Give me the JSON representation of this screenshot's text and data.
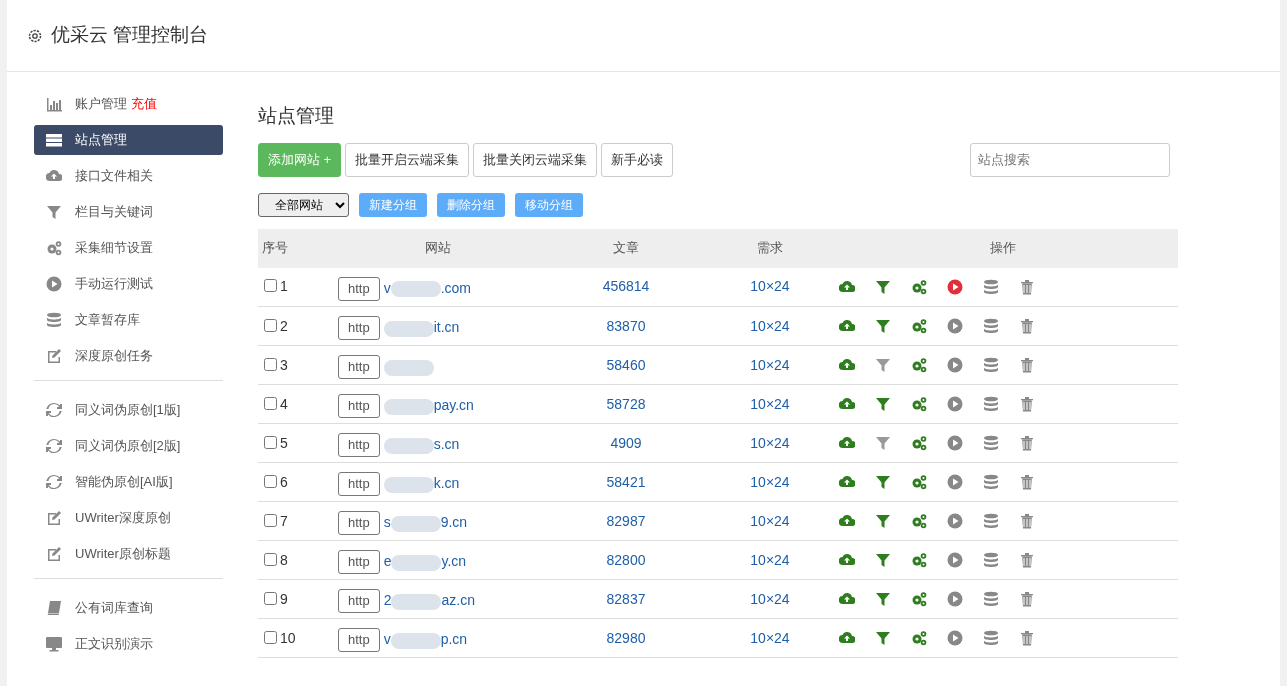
{
  "header": {
    "title": "优采云 管理控制台"
  },
  "sidebar": {
    "groups": [
      {
        "items": [
          {
            "label": "账户管理",
            "badge": "充值",
            "selected": false
          },
          {
            "label": "站点管理",
            "selected": true
          },
          {
            "label": "接口文件相关",
            "selected": false
          },
          {
            "label": "栏目与关键词",
            "selected": false
          },
          {
            "label": "采集细节设置",
            "selected": false
          },
          {
            "label": "手动运行测试",
            "selected": false
          },
          {
            "label": "文章暂存库",
            "selected": false
          },
          {
            "label": "深度原创任务",
            "selected": false
          }
        ]
      },
      {
        "items": [
          {
            "label": "同义词伪原创[1版]",
            "selected": false
          },
          {
            "label": "同义词伪原创[2版]",
            "selected": false
          },
          {
            "label": "智能伪原创[AI版]",
            "selected": false
          },
          {
            "label": "UWriter深度原创",
            "selected": false
          },
          {
            "label": "UWriter原创标题",
            "selected": false
          }
        ]
      },
      {
        "items": [
          {
            "label": "公有词库查询",
            "selected": false
          },
          {
            "label": "正文识别演示",
            "selected": false
          }
        ]
      }
    ]
  },
  "main": {
    "title": "站点管理",
    "buttons": [
      {
        "label": "添加网站 +",
        "kind": "primary"
      },
      {
        "label": "批量开启云端采集",
        "kind": "outline"
      },
      {
        "label": "批量关闭云端采集",
        "kind": "outline"
      },
      {
        "label": "新手必读",
        "kind": "outline"
      }
    ],
    "search": {
      "placeholder": "站点搜索"
    },
    "group_select": {
      "value": "全部网站"
    },
    "group_buttons": [
      "新建分组",
      "删除分组",
      "移动分组"
    ],
    "table": {
      "columns": [
        "序号",
        "网站",
        "文章",
        "需求",
        "操作"
      ],
      "rows": [
        {
          "index": "1",
          "checked": false,
          "protocol": "http",
          "site_start": "v",
          "site_end": ".com",
          "articles": "456814",
          "demand": "10×24",
          "filter_on": true,
          "running": true
        },
        {
          "index": "2",
          "checked": false,
          "protocol": "http",
          "site_end": "it.cn",
          "articles": "83870",
          "demand": "10×24",
          "filter_on": true,
          "running": false
        },
        {
          "index": "3",
          "checked": false,
          "protocol": "http",
          "articles": "58460",
          "demand": "10×24",
          "filter_on": false,
          "running": false
        },
        {
          "index": "4",
          "checked": false,
          "protocol": "http",
          "site_end": "pay.cn",
          "articles": "58728",
          "demand": "10×24",
          "filter_on": true,
          "running": false
        },
        {
          "index": "5",
          "checked": false,
          "protocol": "http",
          "site_end": "s.cn",
          "articles": "4909",
          "demand": "10×24",
          "filter_on": false,
          "running": false
        },
        {
          "index": "6",
          "checked": false,
          "protocol": "http",
          "site_end": "k.cn",
          "articles": "58421",
          "demand": "10×24",
          "filter_on": true,
          "running": false
        },
        {
          "index": "7",
          "checked": false,
          "protocol": "http",
          "site_start": "s",
          "site_end": "9.cn",
          "articles": "82987",
          "demand": "10×24",
          "filter_on": true,
          "running": false
        },
        {
          "index": "8",
          "checked": false,
          "protocol": "http",
          "site_start": "e",
          "site_end": "y.cn",
          "articles": "82800",
          "demand": "10×24",
          "filter_on": true,
          "running": false
        },
        {
          "index": "9",
          "checked": false,
          "protocol": "http",
          "site_start": "2",
          "site_end": "az.cn",
          "articles": "82837",
          "demand": "10×24",
          "filter_on": true,
          "running": false
        },
        {
          "index": "10",
          "checked": false,
          "protocol": "http",
          "site_start": "v",
          "site_end": "p.cn",
          "articles": "82980",
          "demand": "10×24",
          "filter_on": true,
          "running": false
        }
      ]
    }
  }
}
